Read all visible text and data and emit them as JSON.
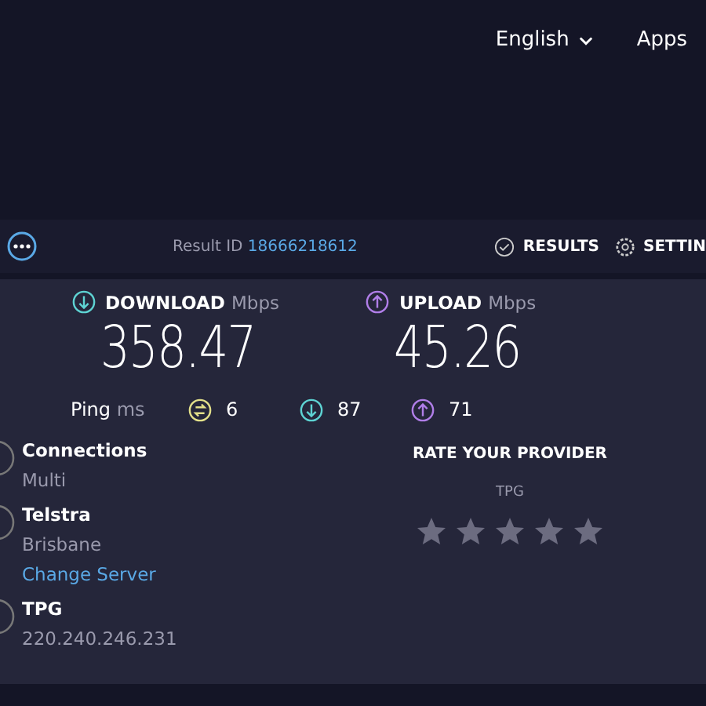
{
  "nav": {
    "language": "English",
    "apps": "Apps"
  },
  "result_bar": {
    "result_label": "Result ID",
    "result_id": "18666218612",
    "results": "RESULTS",
    "settings": "SETTIN"
  },
  "speeds": [
    {
      "kind": "download",
      "label": "DOWNLOAD",
      "unit": "Mbps",
      "value": "358.47"
    },
    {
      "kind": "upload",
      "label": "UPLOAD",
      "unit": "Mbps",
      "value": "45.26"
    }
  ],
  "ping": {
    "label": "Ping",
    "unit": "ms",
    "readings": [
      {
        "kind": "idle",
        "value": "6"
      },
      {
        "kind": "download",
        "value": "87"
      },
      {
        "kind": "upload",
        "value": "71"
      }
    ]
  },
  "info": [
    {
      "title": "Connections",
      "detail": "Multi"
    },
    {
      "title": "Telstra",
      "detail": "Brisbane",
      "link": "Change Server"
    },
    {
      "title": "TPG",
      "detail": "220.240.246.231"
    }
  ],
  "rating": {
    "title": "RATE YOUR PROVIDER",
    "provider": "TPG",
    "stars": 0
  }
}
